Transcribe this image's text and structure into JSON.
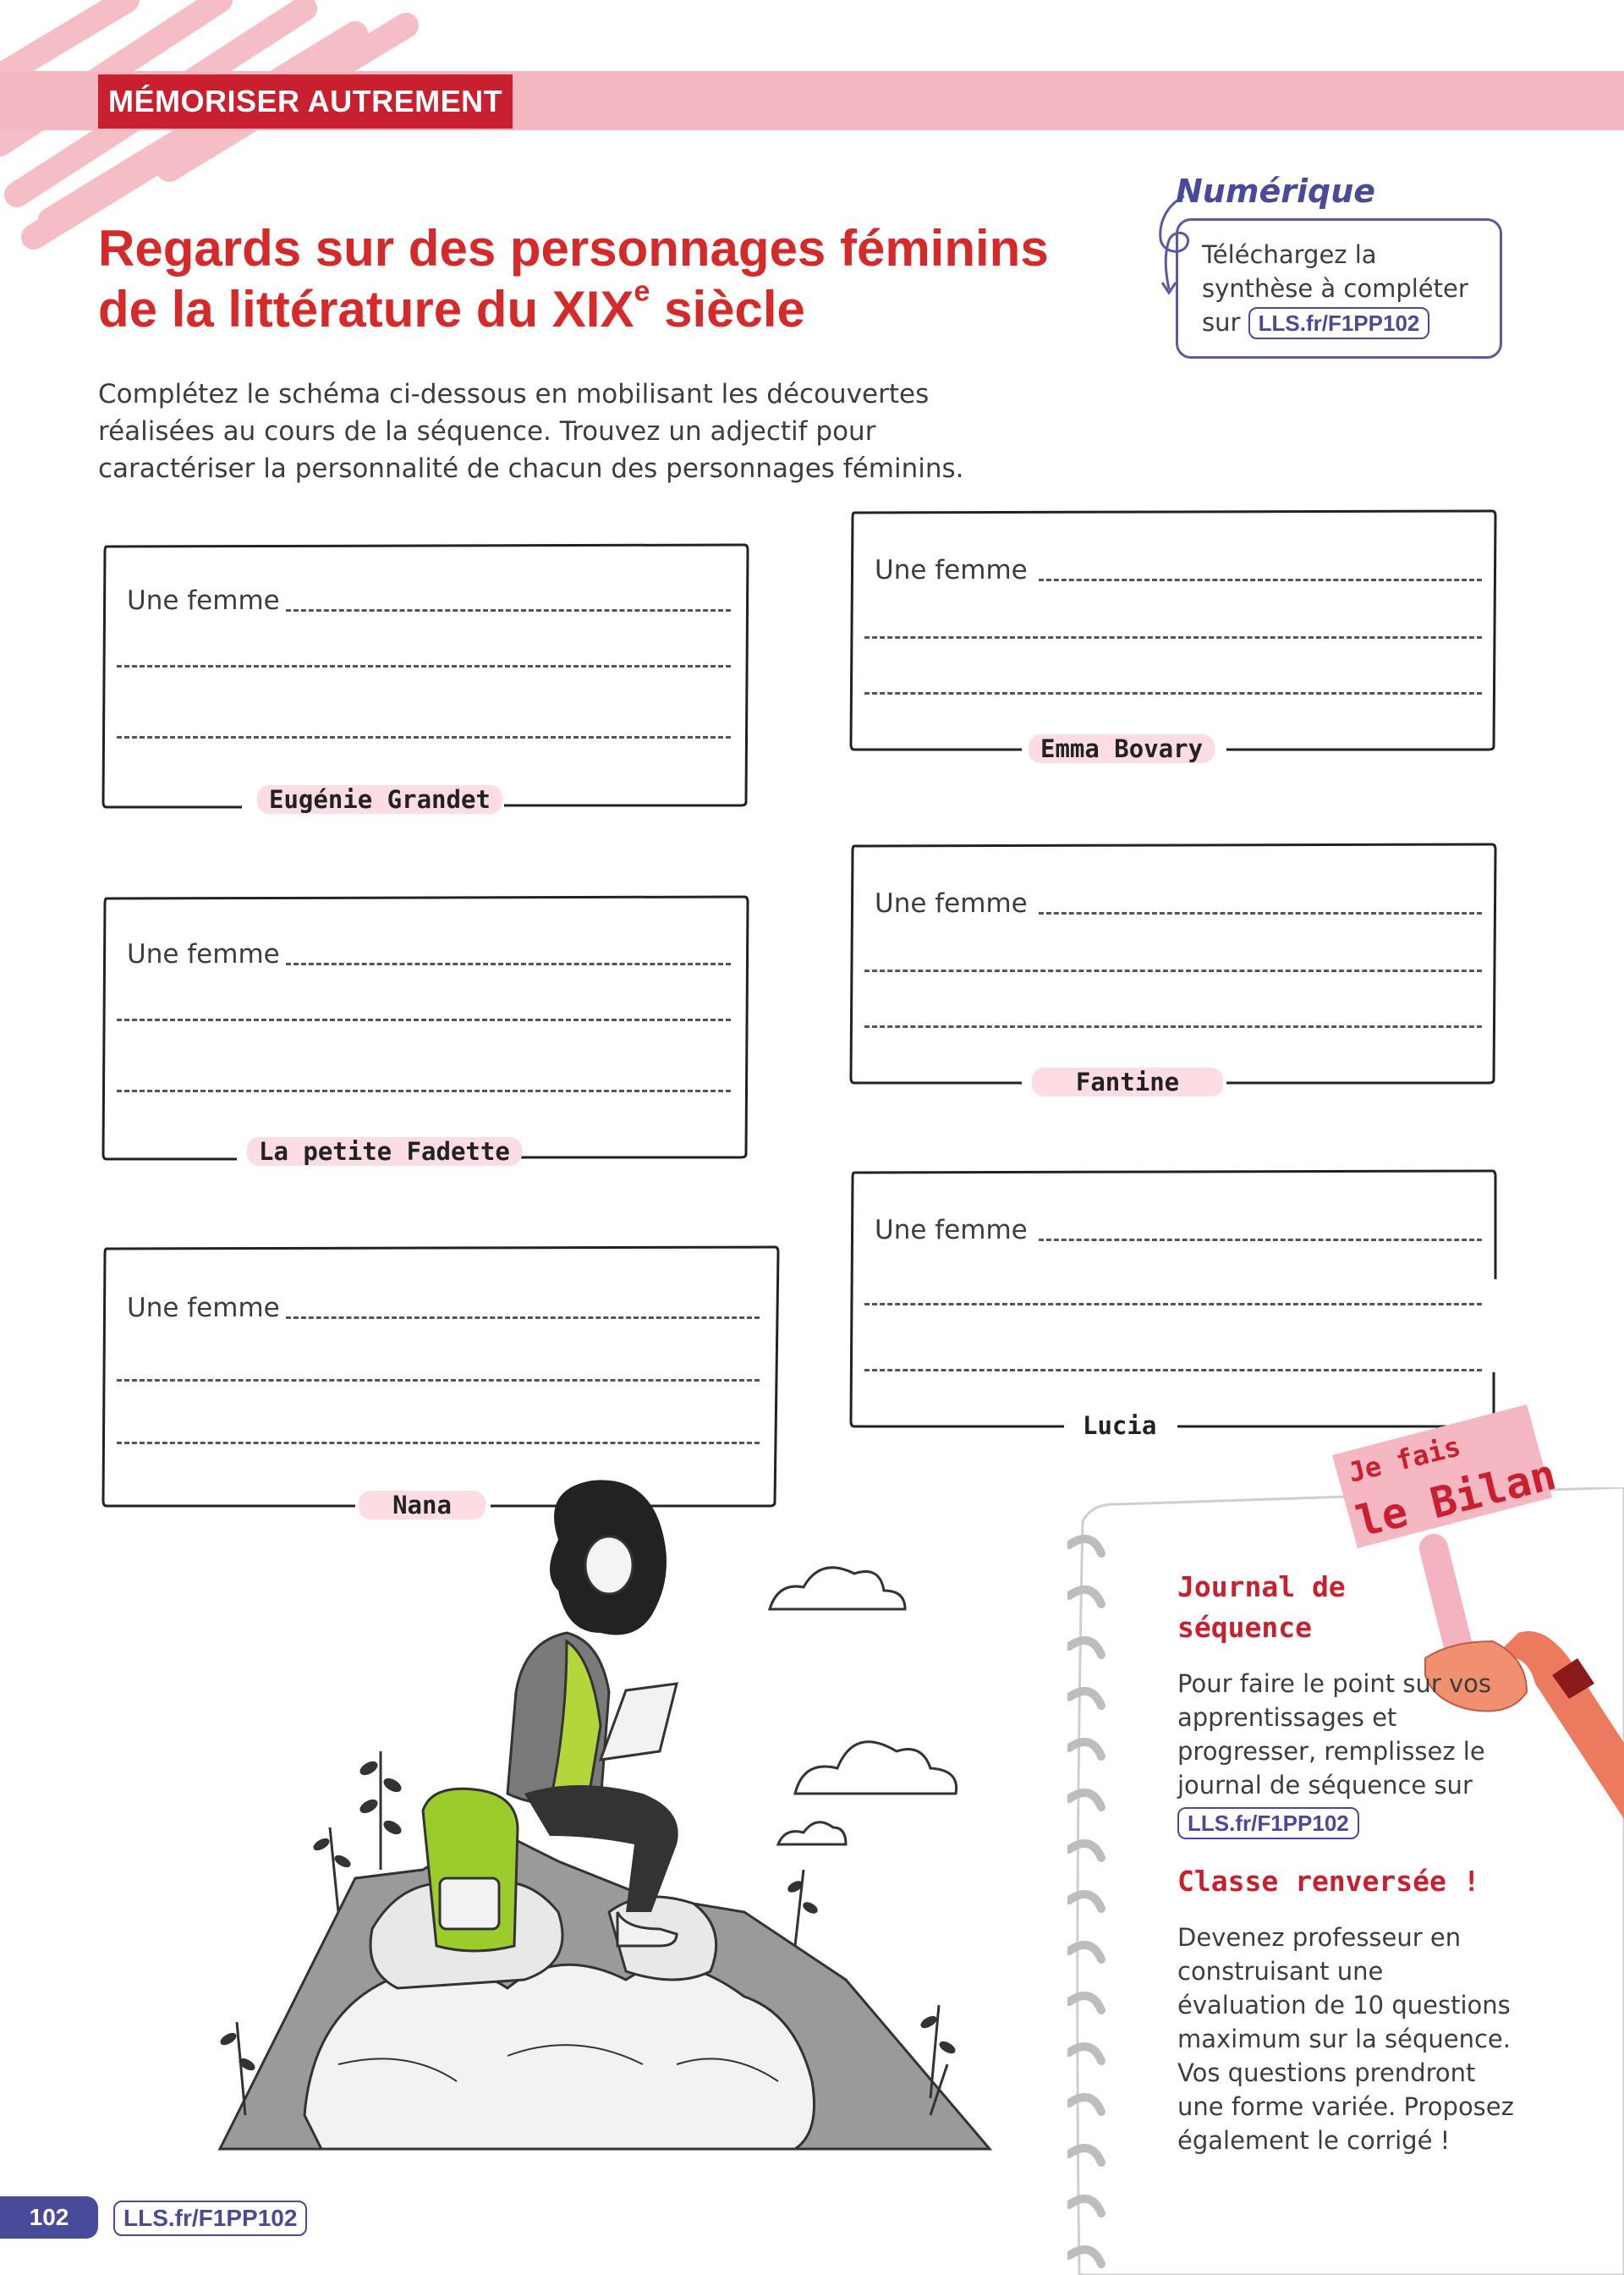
{
  "header": {
    "section_label": "MÉMORISER AUTREMENT"
  },
  "title": {
    "line1": "Regards sur des personnages féminins",
    "line2_a": "de la littérature du XIX",
    "line2_sup": "e",
    "line2_b": " siècle"
  },
  "instructions": "Complétez le schéma ci-dessous en mobilisant les découvertes réalisées au cours de la séquence. Trouvez un adjectif pour caractériser la personnalité de chacun des personnages féminins.",
  "numerique": {
    "label": "Numérique",
    "text_1": "Téléchargez la",
    "text_2": "synthèse à compléter",
    "text_3": "sur",
    "link": "LLS.fr/F1PP102"
  },
  "cards": [
    {
      "prompt": "Une femme",
      "name": "Eugénie Grandet"
    },
    {
      "prompt": "Une femme",
      "name": "Emma Bovary"
    },
    {
      "prompt": "Une femme",
      "name": "La petite Fadette"
    },
    {
      "prompt": "Une femme",
      "name": "Fantine"
    },
    {
      "prompt": "Une femme",
      "name": "Nana"
    },
    {
      "prompt": "Une femme",
      "name": "Lucia"
    }
  ],
  "bilan": {
    "sign_line1": "Je fais",
    "sign_line2": "le Bilan",
    "journal_title": "Journal de séquence",
    "journal_text": "Pour faire le point sur vos apprentissages et progresser, remplissez le journal de séquence sur",
    "journal_link": "LLS.fr/F1PP102",
    "classe_title": "Classe renversée !",
    "classe_text": "Devenez professeur en construisant une évaluation de 10 questions maximum sur la séquence. Vos questions prendront une forme variée. Proposez également le corrigé !"
  },
  "footer": {
    "page_number": "102",
    "link": "LLS.fr/F1PP102"
  },
  "colors": {
    "accent_red": "#c8202f",
    "title_red": "#d42a2a",
    "pink_band": "#f5b7c2",
    "purple": "#4a4a9a",
    "name_tag_bg": "#fbdde3"
  }
}
